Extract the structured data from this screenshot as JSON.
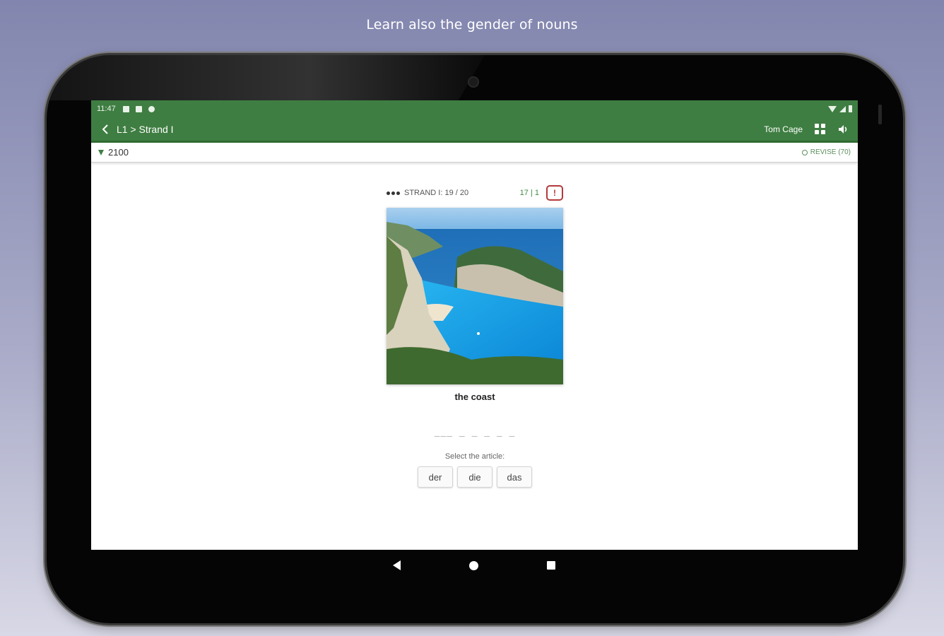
{
  "headline": "Learn also the gender of nouns",
  "statusbar": {
    "time": "11:47"
  },
  "appbar": {
    "breadcrumb": "L1 > Strand I",
    "user": "Tom Cage"
  },
  "subbar": {
    "points": "2100",
    "revise": "REVISE (70)"
  },
  "card": {
    "progress": "STRAND I: 19 / 20",
    "score": "17 | 1",
    "report_label": "!",
    "word": "the coast",
    "blanks": "___  _ _ _ _ _",
    "prompt": "Select the article:",
    "articles": [
      "der",
      "die",
      "das"
    ]
  },
  "colors": {
    "brand_green": "#3f7e42",
    "report_red": "#b23a3a",
    "sea_blue": "#1a96e6"
  },
  "icons": [
    "back-arrow-icon",
    "grid-icon",
    "speaker-icon",
    "gem-icon",
    "revise-icon",
    "nav-back-icon",
    "nav-home-icon",
    "nav-recent-icon"
  ]
}
